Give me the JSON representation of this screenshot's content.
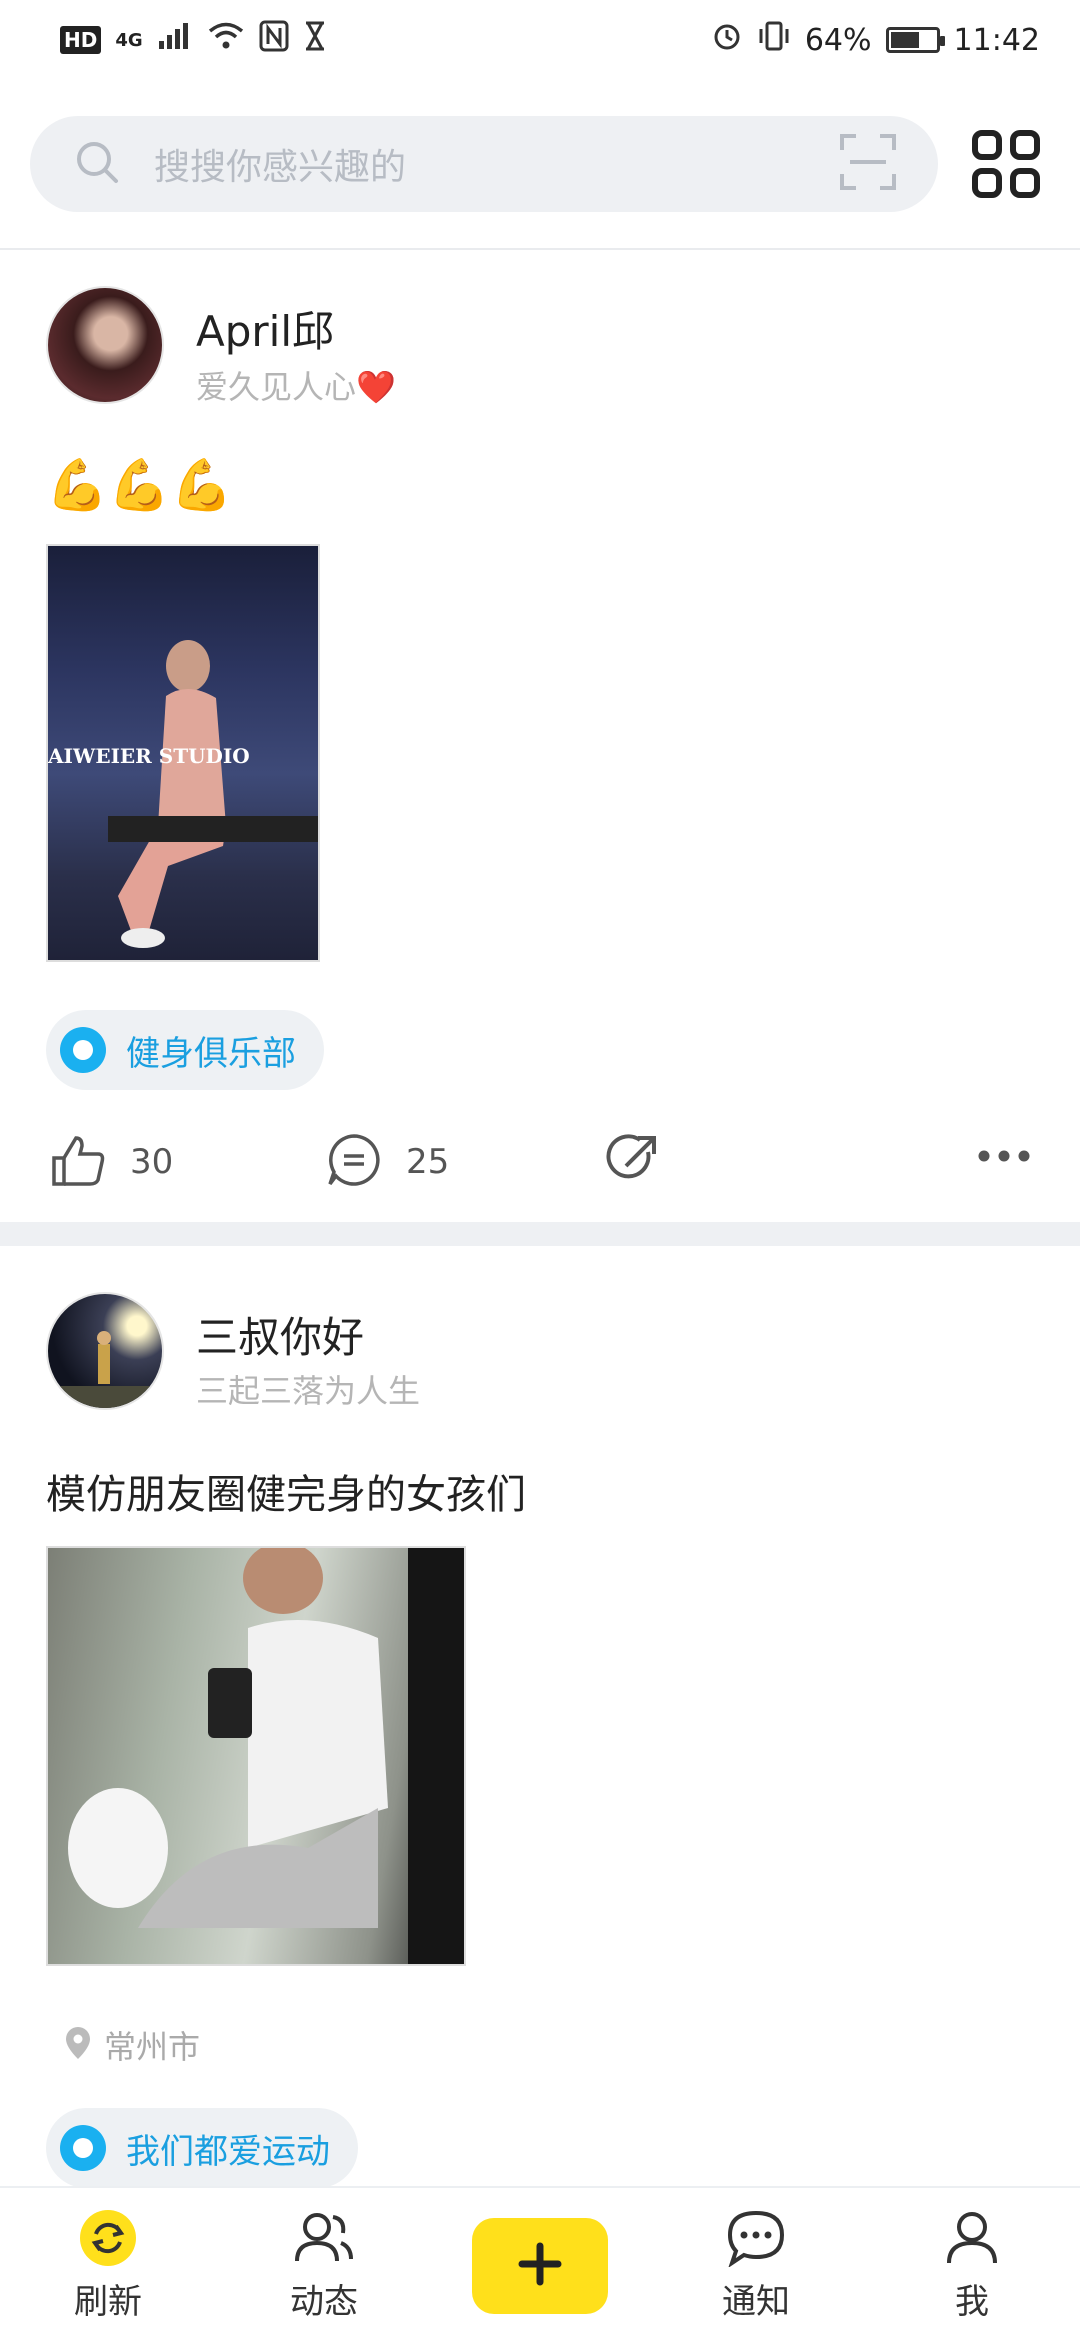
{
  "status_bar": {
    "left_badges": [
      "HD",
      "4G"
    ],
    "battery_percent": "64%",
    "battery_level": 0.64,
    "time": "11:42"
  },
  "search": {
    "placeholder": "搜搜你感兴趣的"
  },
  "posts": [
    {
      "username": "April邱",
      "signature": "爱久见人心❤️",
      "text": "💪💪💪",
      "photo_caption": "AIWEIER STUDIO",
      "tag": "健身俱乐部",
      "likes": "30",
      "comments": "25"
    },
    {
      "username": "三叔你好",
      "signature": "三起三落为人生",
      "text": "模仿朋友圈健完身的女孩们",
      "location": "常州市",
      "tag": "我们都爱运动"
    }
  ],
  "bottom_nav": {
    "items": [
      {
        "label": "刷新",
        "icon": "refresh-icon"
      },
      {
        "label": "动态",
        "icon": "people-icon"
      },
      {
        "label": "",
        "icon": "plus-icon"
      },
      {
        "label": "通知",
        "icon": "message-icon"
      },
      {
        "label": "我",
        "icon": "user-icon"
      }
    ]
  },
  "colors": {
    "accent_yellow": "#ffe01b",
    "tag_blue": "#1ab0f0",
    "search_bg": "#eef0f3"
  }
}
